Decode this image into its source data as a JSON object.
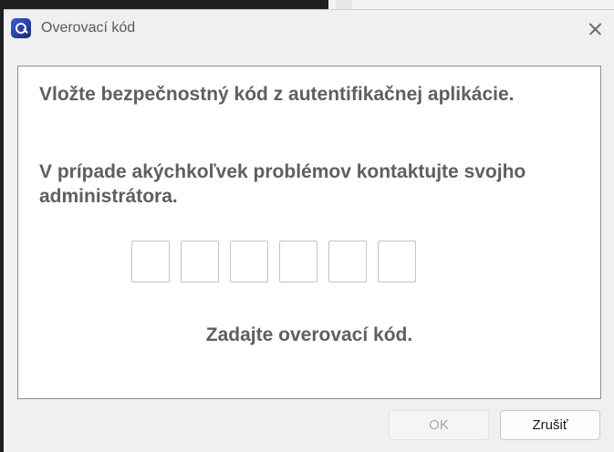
{
  "window": {
    "title": "Overovací kód",
    "icon": "app-logo-icon",
    "close_icon": "close-icon"
  },
  "content": {
    "instruction_1": "Vložte bezpečnostný kód z autentifikačnej aplikácie.",
    "instruction_2": "V prípade akýchkoľvek problémov kontaktujte svojho administrátora.",
    "code_digits": [
      "",
      "",
      "",
      "",
      "",
      ""
    ],
    "status": "Zadajte overovací kód."
  },
  "buttons": {
    "ok_label": "OK",
    "ok_enabled": false,
    "cancel_label": "Zrušiť"
  },
  "colors": {
    "app_icon": "#263e9e",
    "text": "#5f5f5f",
    "disabled_text": "#a8a8a8"
  }
}
